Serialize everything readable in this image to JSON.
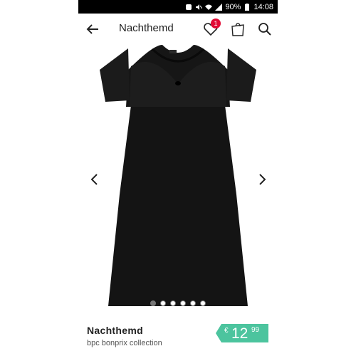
{
  "status_bar": {
    "battery": "90%",
    "time": "14:08"
  },
  "header": {
    "title": "Nachthemd",
    "wishlist_count": "1"
  },
  "gallery": {
    "image_count": 6,
    "active_index": 0
  },
  "product": {
    "name": "Nachthemd",
    "brand": "bpc bonprix collection",
    "price": {
      "currency": "€",
      "whole": "12",
      "cents": "99"
    }
  },
  "colors": {
    "accent_red": "#e10a34",
    "price_green": "#4cc49e",
    "dress": "#141414"
  },
  "icons": [
    "back-arrow-icon",
    "heart-icon",
    "shopping-bag-icon",
    "search-icon",
    "chevron-left-icon",
    "chevron-right-icon"
  ]
}
